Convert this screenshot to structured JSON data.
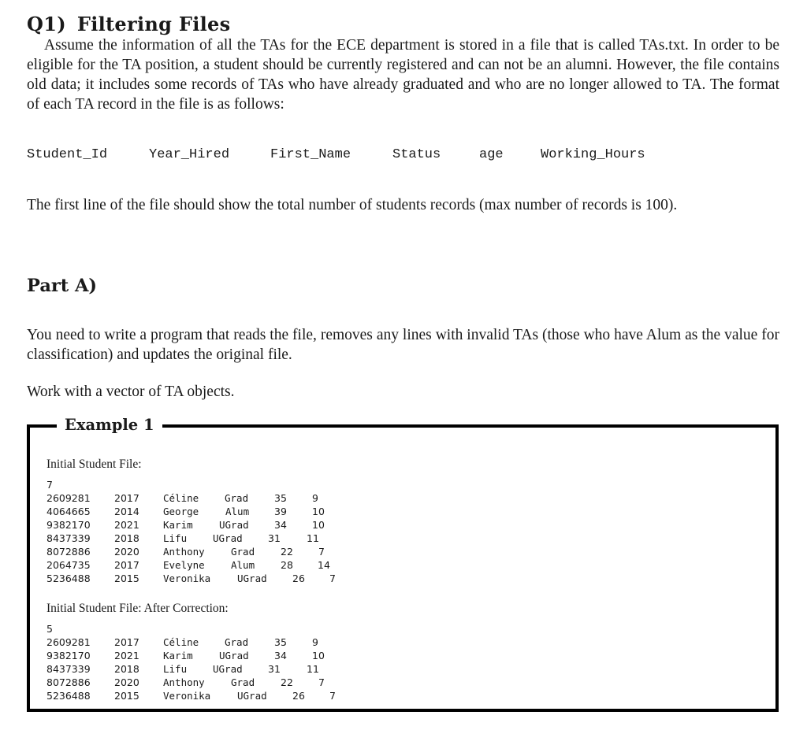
{
  "question": {
    "number": "Q1)",
    "title": "Filtering Files",
    "intro": "Assume the information of all the TAs for the ECE department is stored in a file that is called TAs.txt. In order to be eligible for the TA position, a student should be currently registered and can not be an alumni. However, the file contains old data; it includes some records of TAs who have already graduated and who are no longer allowed to TA. The format of each TA record in the file is as follows:",
    "format_fields": [
      "Student_Id",
      "Year_Hired",
      "First_Name",
      "Status",
      "age",
      "Working_Hours"
    ],
    "first_line_note": "The first line of the file should show the total number of students records (max number of records is 100)."
  },
  "part_a": {
    "heading": "Part A)",
    "task": "You need to write a program that reads the file, removes any lines with invalid TAs (those who have Alum as the value for classification) and updates the original file.",
    "instruction": "Work with a vector of TA objects."
  },
  "example": {
    "title": "Example 1",
    "initial": {
      "caption": "Initial Student File:",
      "count": "7",
      "rows": [
        [
          "2609281",
          "2017",
          "Céline",
          "Grad",
          "35",
          "9"
        ],
        [
          "4064665",
          "2014",
          "George",
          "Alum",
          "39",
          "10"
        ],
        [
          "9382170",
          "2021",
          "Karim",
          "UGrad",
          "34",
          "10"
        ],
        [
          "8437339",
          "2018",
          "Lifu",
          "UGrad",
          "31",
          "11"
        ],
        [
          "8072886",
          "2020",
          "Anthony",
          "Grad",
          "22",
          "7"
        ],
        [
          "2064735",
          "2017",
          "Evelyne",
          "Alum",
          "28",
          "14"
        ],
        [
          "5236488",
          "2015",
          "Veronika",
          "UGrad",
          "26",
          "7"
        ]
      ]
    },
    "corrected": {
      "caption": "Initial Student File: After Correction:",
      "count": "5",
      "rows": [
        [
          "2609281",
          "2017",
          "Céline",
          "Grad",
          "35",
          "9"
        ],
        [
          "9382170",
          "2021",
          "Karim",
          "UGrad",
          "34",
          "10"
        ],
        [
          "8437339",
          "2018",
          "Lifu",
          "UGrad",
          "31",
          "11"
        ],
        [
          "8072886",
          "2020",
          "Anthony",
          "Grad",
          "22",
          "7"
        ],
        [
          "5236488",
          "2015",
          "Veronika",
          "UGrad",
          "26",
          "7"
        ]
      ]
    }
  }
}
